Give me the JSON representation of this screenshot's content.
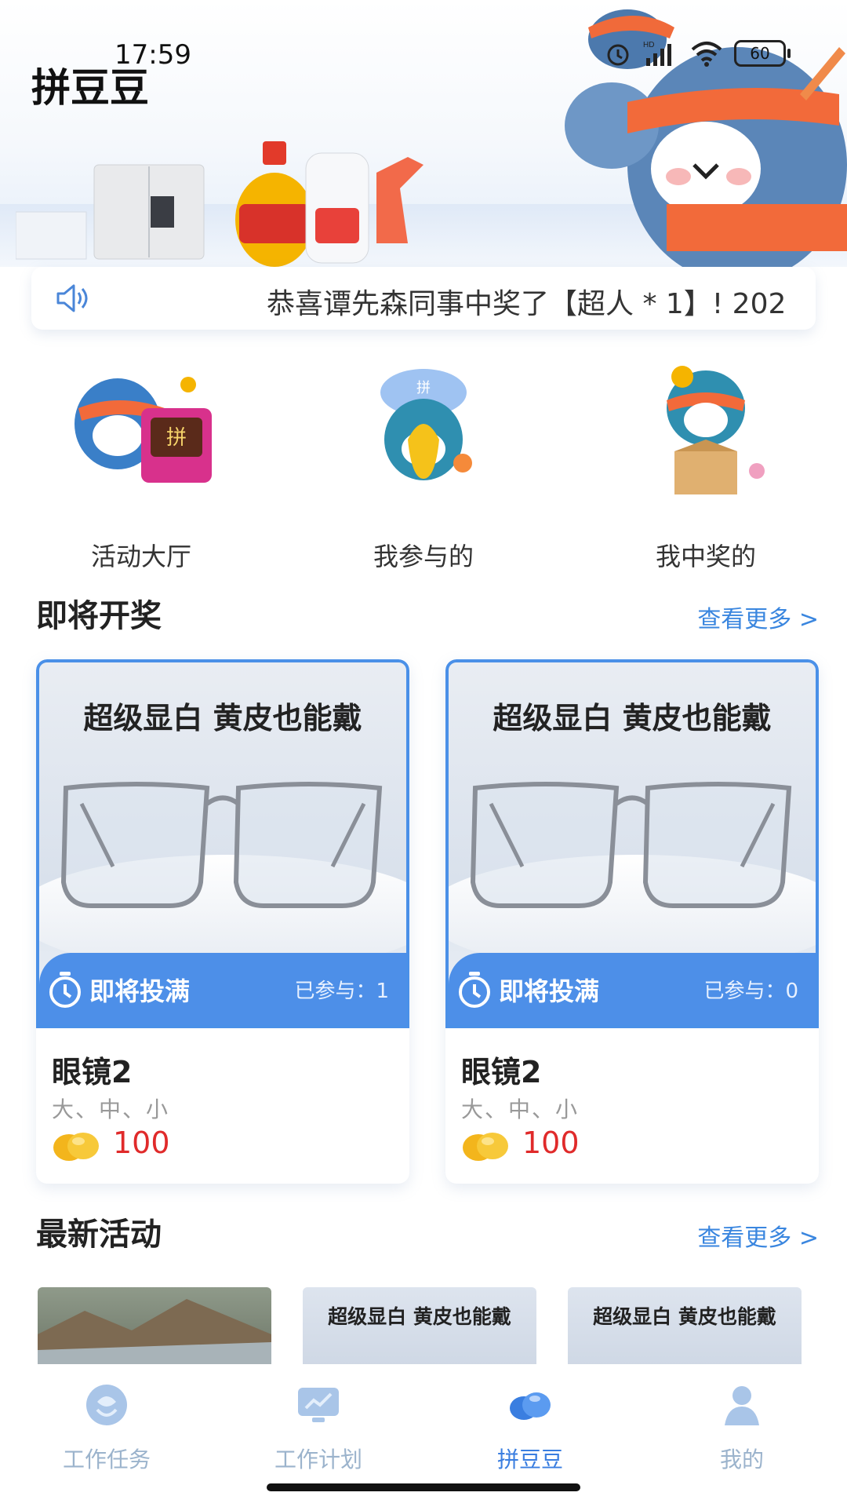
{
  "status_bar": {
    "time": "17:59",
    "battery": "60"
  },
  "header": {
    "app_title": "拼豆豆"
  },
  "notice": {
    "text": "恭喜谭先森同事中奖了【超人 * 1】! 202"
  },
  "quick_entries": [
    {
      "label": "活动大厅"
    },
    {
      "label": "我参与的"
    },
    {
      "label": "我中奖的"
    }
  ],
  "upcoming": {
    "title": "即将开奖",
    "more": "查看更多 >",
    "cards": [
      {
        "slogan": "超级显白 黄皮也能戴",
        "status": "即将投满",
        "joined": "已参与：1",
        "name": "眼镜2",
        "sizes": "大、中、小",
        "price": "100"
      },
      {
        "slogan": "超级显白 黄皮也能戴",
        "status": "即将投满",
        "joined": "已参与：0",
        "name": "眼镜2",
        "sizes": "大、中、小",
        "price": "100"
      }
    ]
  },
  "latest": {
    "title": "最新活动",
    "more": "查看更多 >",
    "thumbs": [
      {
        "text": ""
      },
      {
        "text": "超级显白 黄皮也能戴"
      },
      {
        "text": "超级显白 黄皮也能戴"
      }
    ]
  },
  "tabbar": {
    "tabs": [
      {
        "label": "工作任务",
        "icon": "task-icon"
      },
      {
        "label": "工作计划",
        "icon": "plan-icon"
      },
      {
        "label": "拼豆豆",
        "icon": "beans-icon",
        "active": true
      },
      {
        "label": "我的",
        "icon": "profile-icon"
      }
    ]
  },
  "colors": {
    "accent": "#3a86df",
    "price": "#e02a2a",
    "card_strip": "#4d8fe8"
  }
}
